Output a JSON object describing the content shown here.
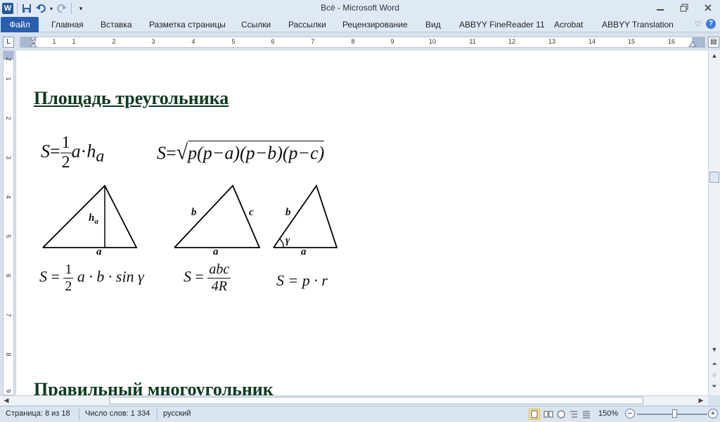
{
  "window": {
    "title": "Всё  -  Microsoft Word",
    "app_icon": "W",
    "controls": [
      "minimize-icon",
      "restore-icon",
      "close-icon"
    ]
  },
  "ribbon": {
    "tabs": [
      {
        "label": "Файл",
        "active": true
      },
      {
        "label": "Главная"
      },
      {
        "label": "Вставка"
      },
      {
        "label": "Разметка страницы"
      },
      {
        "label": "Ссылки"
      },
      {
        "label": "Рассылки"
      },
      {
        "label": "Рецензирование"
      },
      {
        "label": "Вид"
      },
      {
        "label": "ABBYY FineReader 11"
      },
      {
        "label": "Acrobat"
      },
      {
        "label": "ABBYY Translation"
      }
    ]
  },
  "ruler": {
    "corner": "L",
    "numbers": [
      "2",
      "1",
      "1",
      "2",
      "3",
      "4",
      "5",
      "6",
      "7",
      "8",
      "9",
      "10",
      "11",
      "12",
      "13",
      "14",
      "15",
      "16"
    ],
    "vnumbers": [
      "2",
      "1",
      "2",
      "3",
      "4",
      "5",
      "6",
      "7",
      "8",
      "9"
    ]
  },
  "document": {
    "heading1": "Площадь треугольника",
    "heading2": "Правильный многоугольник",
    "formula1": {
      "lhs": "S",
      "eq": "=",
      "num": "1",
      "den": "2",
      "a": "a",
      "dot": "·",
      "h": "h",
      "sub": "a"
    },
    "formula2": {
      "lhs": "S",
      "eq": "=",
      "body": "p(p−a)(p−b)(p−c)"
    },
    "formula3": {
      "lhs": "S",
      "eq": "=",
      "num": "1",
      "den": "2",
      "rest": "a · b · sin γ"
    },
    "formula4": {
      "lhs": "S",
      "eq": "=",
      "num": "abc",
      "den": "4R"
    },
    "formula5": {
      "text": "S = p · r"
    },
    "triangle_labels": {
      "t1": {
        "h": "h",
        "h_sub": "a",
        "base": "a"
      },
      "t2": {
        "left": "b",
        "right": "c",
        "base": "a"
      },
      "t3": {
        "left": "b",
        "angle": "γ",
        "base": "a"
      }
    }
  },
  "statusbar": {
    "page": "Страница: 8 из 18",
    "words": "Число слов: 1 334",
    "language": "русский",
    "zoom": "150%",
    "zoom_minus": "−",
    "zoom_plus": "+",
    "zoom_level_pct": 150
  }
}
